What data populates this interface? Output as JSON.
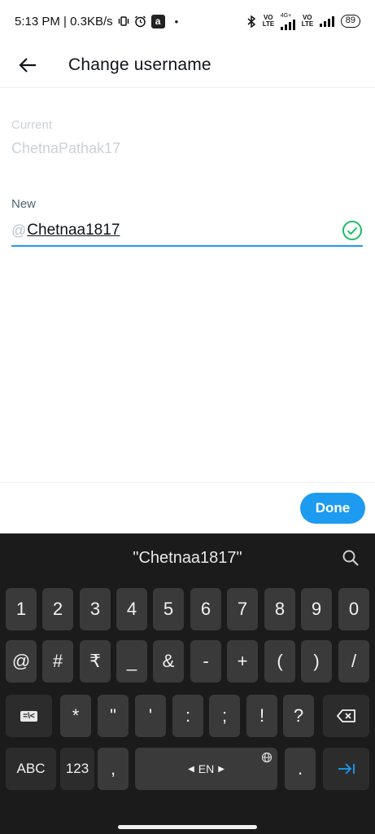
{
  "status_bar": {
    "time_speed": "5:13 PM | 0.3KB/s",
    "volte_1": "VO LTE",
    "volte_2": "VO LTE",
    "net_type": "4G+",
    "battery": "89"
  },
  "header": {
    "title": "Change username"
  },
  "form": {
    "current_label": "Current",
    "current_value": "ChetnaPathak17",
    "new_label": "New",
    "at_prefix": "@",
    "new_value": "Chetnaa1817"
  },
  "action": {
    "done_label": "Done"
  },
  "keyboard": {
    "suggestion": "\"Chetnaa1817\"",
    "row1": [
      "1",
      "2",
      "3",
      "4",
      "5",
      "6",
      "7",
      "8",
      "9",
      "0"
    ],
    "row2": [
      "@",
      "#",
      "₹",
      "_",
      "&",
      "-",
      "+",
      "(",
      ")",
      "/"
    ],
    "row3": [
      "=\\<",
      "*",
      "\"",
      "'",
      ":",
      ";",
      "!",
      "?"
    ],
    "abc": "ABC",
    "num": "123",
    "comma": ",",
    "space_lang": "EN",
    "period": "."
  },
  "colors": {
    "accent": "#1d9bf0",
    "valid": "#17bf63"
  }
}
